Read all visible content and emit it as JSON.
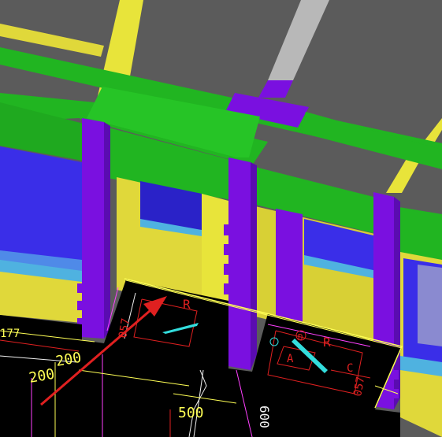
{
  "viewport": {
    "type": "cad-3d-viewport",
    "colors": {
      "slab": "#5b5b5b",
      "beam": "#21b521",
      "beam_dark": "#1c9a1c",
      "column": "#7a10e0",
      "column_dark": "#5a0cb0",
      "wall": "#e0d83a",
      "wall_shade": "#c9c232",
      "window_blue": "#3a2ee8",
      "window_cyan": "#4fb2e0",
      "cad_bg": "#000000",
      "cad_yellow": "#ffff55",
      "cad_red": "#e02020",
      "cad_magenta": "#ff40ff",
      "cad_cyan": "#33dddd",
      "cad_white": "#f0f0f0"
    }
  },
  "annotations": {
    "dim_177": "177",
    "dim_200_upper": "200",
    "dim_200_lower": "200",
    "dim_500": "500",
    "dim_600": "600",
    "dim_057_left": "057",
    "dim_057_right": "057",
    "tag_r_left": "R",
    "tag_r_right": "R",
    "tag_a": "A",
    "tag_c": "C",
    "tag_d": "D"
  },
  "icons": [
    "red-arrow-icon",
    "cyan-arrow-icon"
  ]
}
